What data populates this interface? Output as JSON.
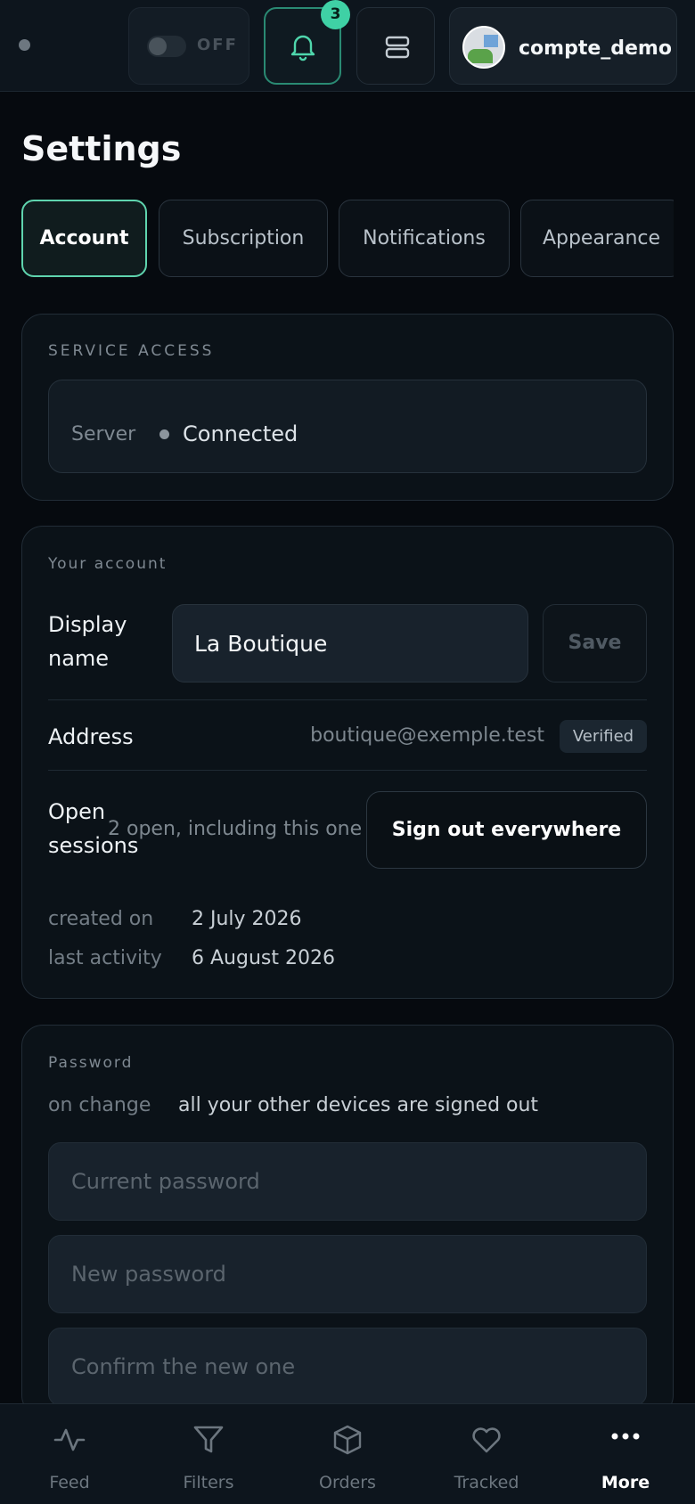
{
  "topbar": {
    "toggle_label": "OFF",
    "notification_count": "3",
    "username": "compte_demo"
  },
  "page": {
    "title": "Settings"
  },
  "tabs": [
    {
      "label": "Account",
      "active": true
    },
    {
      "label": "Subscription",
      "active": false
    },
    {
      "label": "Notifications",
      "active": false
    },
    {
      "label": "Appearance",
      "active": false
    }
  ],
  "service_access": {
    "heading": "SERVICE ACCESS",
    "server_label": "Server",
    "server_status": "Connected"
  },
  "account": {
    "heading": "Your account",
    "display_name_label": "Display name",
    "display_name_value": "La Boutique",
    "save_label": "Save",
    "address_label": "Address",
    "address_value": "boutique@exemple.test",
    "verified_badge": "Verified",
    "sessions_label": "Open sessions",
    "sessions_note": "2 open, including this one",
    "signout_label": "Sign out everywhere",
    "created_label": "created on",
    "created_value": "2 July 2026",
    "activity_label": "last activity",
    "activity_value": "6 August 2026"
  },
  "password": {
    "heading": "Password",
    "note_label": "on change",
    "note_value": "all your other devices are signed out",
    "current_placeholder": "Current password",
    "new_placeholder": "New password",
    "confirm_placeholder": "Confirm the new one"
  },
  "bottom_nav": [
    {
      "label": "Feed",
      "icon": "activity-icon",
      "active": false
    },
    {
      "label": "Filters",
      "icon": "filter-icon",
      "active": false
    },
    {
      "label": "Orders",
      "icon": "box-icon",
      "active": false
    },
    {
      "label": "Tracked",
      "icon": "heart-icon",
      "active": false
    },
    {
      "label": "More",
      "icon": "more-icon",
      "active": true
    }
  ],
  "colors": {
    "accent": "#3fd1a5",
    "background": "#060a0f",
    "card": "#0b1218"
  }
}
